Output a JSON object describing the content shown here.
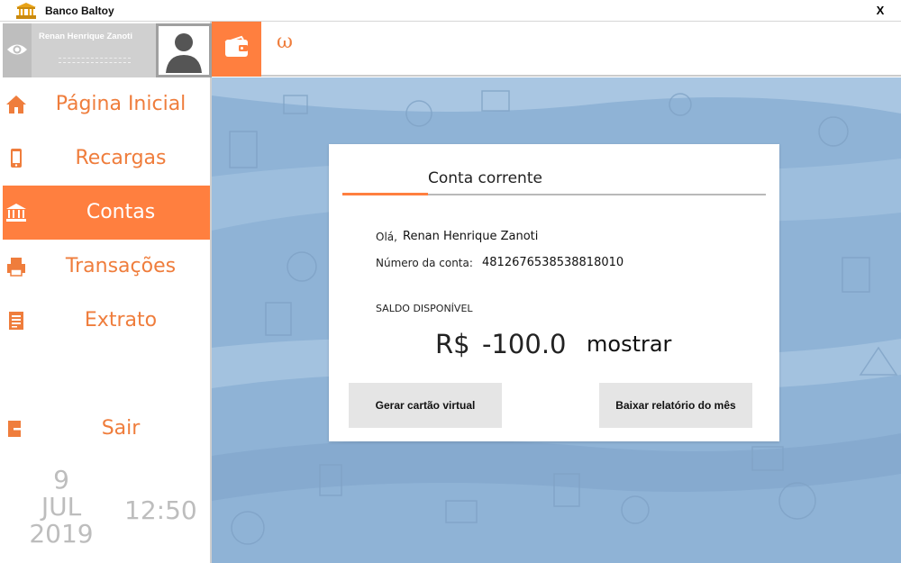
{
  "window": {
    "title": "Banco Baltoy",
    "close_label": "X"
  },
  "profile": {
    "name": "Renan Henrique Zanoti"
  },
  "nav": {
    "items": [
      {
        "label": "Página Inicial",
        "icon": "home-icon"
      },
      {
        "label": "Recargas",
        "icon": "phone-icon"
      },
      {
        "label": "Contas",
        "icon": "bank-icon",
        "active": true
      },
      {
        "label": "Transações",
        "icon": "printer-icon"
      },
      {
        "label": "Extrato",
        "icon": "statement-icon"
      }
    ],
    "logout_label": "Sair"
  },
  "datetime": {
    "day": "9",
    "month": "JUL",
    "year": "2019",
    "time": "12:50"
  },
  "topbar": {
    "glyph": "ω"
  },
  "card": {
    "tab_title": "Conta corrente",
    "greeting_label": "Olá,",
    "greeting_name": "Renan Henrique Zanoti",
    "account_label": "Número da conta:",
    "account_number": "4812676538538818010",
    "balance_label": "SALDO DISPONÍVEL",
    "currency": "R$",
    "balance": "-100.0",
    "show_label": "mostrar",
    "btn_virtual_card": "Gerar cartão virtual",
    "btn_monthly_report": "Baixar relatório do mês"
  },
  "colors": {
    "accent": "#ff7f3f",
    "accent_text": "#ef7d3c",
    "background_blue": "#8fb3d6"
  }
}
